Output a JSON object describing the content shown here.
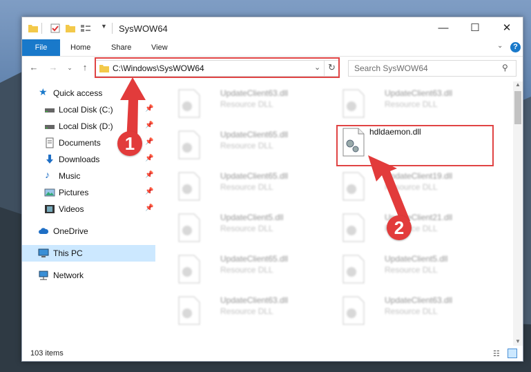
{
  "window": {
    "title": "SysWOW64"
  },
  "ribbon": {
    "tabs": [
      "File",
      "Home",
      "Share",
      "View"
    ]
  },
  "nav": {
    "back_icon": "back-arrow-icon",
    "address": "C:\\Windows\\SysWOW64",
    "search_placeholder": "Search SysWOW64"
  },
  "sidebar": {
    "items": [
      {
        "label": "Quick access",
        "icon": "star-icon"
      },
      {
        "label": "Local Disk (C:)",
        "icon": "drive-icon",
        "pinned": true
      },
      {
        "label": "Local Disk (D:)",
        "icon": "drive-icon",
        "pinned": true
      },
      {
        "label": "Documents",
        "icon": "documents-icon",
        "pinned": true
      },
      {
        "label": "Downloads",
        "icon": "download-icon",
        "pinned": true
      },
      {
        "label": "Music",
        "icon": "music-icon",
        "pinned": true
      },
      {
        "label": "Pictures",
        "icon": "pictures-icon",
        "pinned": true
      },
      {
        "label": "Videos",
        "icon": "videos-icon",
        "pinned": true
      },
      {
        "label": "OneDrive",
        "icon": "cloud-icon"
      },
      {
        "label": "This PC",
        "icon": "computer-icon",
        "selected": true
      },
      {
        "label": "Network",
        "icon": "network-icon"
      }
    ]
  },
  "files": {
    "left": [
      {
        "name": "UpdateClient63.dll",
        "type": "Resource DLL"
      },
      {
        "name": "UpdateClient65.dll",
        "type": "Resource DLL"
      },
      {
        "name": "UpdateClient65.dll",
        "type": "Resource DLL"
      },
      {
        "name": "UpdateClient5.dll",
        "type": "Resource DLL"
      },
      {
        "name": "UpdateClient65.dll",
        "type": "Resource DLL"
      },
      {
        "name": "UpdateClient63.dll",
        "type": "Resource DLL"
      }
    ],
    "right": [
      {
        "name": "UpdateClient63.dll",
        "type": "Resource DLL"
      },
      {
        "name": "hdldaemon.dll",
        "type": ""
      },
      {
        "name": "UpdateClient19.dll",
        "type": "Resource DLL"
      },
      {
        "name": "UpdateClient21.dll",
        "type": "Resource DLL"
      },
      {
        "name": "UpdateClient5.dll",
        "type": "Resource DLL"
      },
      {
        "name": "UpdateClient63.dll",
        "type": "Resource DLL"
      }
    ]
  },
  "status": {
    "count": "103 items"
  },
  "callouts": [
    "1",
    "2"
  ],
  "colors": {
    "accent": "#1979ca",
    "highlight": "#e04343",
    "selected": "#cce8ff"
  }
}
